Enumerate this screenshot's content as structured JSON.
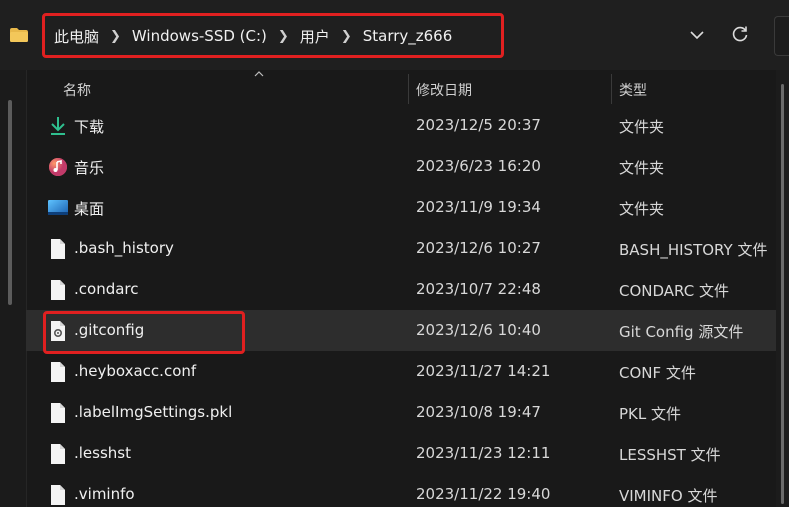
{
  "breadcrumb": [
    {
      "label": "此电脑"
    },
    {
      "label": "Windows-SSD (C:)"
    },
    {
      "label": "用户"
    },
    {
      "label": "Starry_z666"
    }
  ],
  "columns": {
    "name": "名称",
    "modified": "修改日期",
    "type": "类型"
  },
  "files": [
    {
      "name": "下载",
      "modified": "2023/12/5 20:37",
      "type": "文件夹",
      "icon": "download-folder-icon"
    },
    {
      "name": "音乐",
      "modified": "2023/6/23 16:20",
      "type": "文件夹",
      "icon": "music-folder-icon"
    },
    {
      "name": "桌面",
      "modified": "2023/11/9 19:34",
      "type": "文件夹",
      "icon": "desktop-folder-icon"
    },
    {
      "name": ".bash_history",
      "modified": "2023/12/6 10:27",
      "type": "BASH_HISTORY 文件",
      "icon": "file-icon"
    },
    {
      "name": ".condarc",
      "modified": "2023/10/7 22:48",
      "type": "CONDARC 文件",
      "icon": "file-icon"
    },
    {
      "name": ".gitconfig",
      "modified": "2023/12/6 10:40",
      "type": "Git Config 源文件",
      "icon": "config-file-icon",
      "selected": true
    },
    {
      "name": ".heyboxacc.conf",
      "modified": "2023/11/27 14:21",
      "type": "CONF 文件",
      "icon": "file-icon"
    },
    {
      "name": ".labelImgSettings.pkl",
      "modified": "2023/10/8 19:47",
      "type": "PKL 文件",
      "icon": "file-icon"
    },
    {
      "name": ".lesshst",
      "modified": "2023/11/23 12:11",
      "type": "LESSHST 文件",
      "icon": "file-icon"
    },
    {
      "name": ".viminfo",
      "modified": "2023/11/22 19:40",
      "type": "VIMINFO 文件",
      "icon": "file-icon"
    }
  ],
  "colors": {
    "highlight": "#e02020",
    "background": "#191919",
    "selected_row": "#2d2d2d",
    "accent_green": "#2fbf8f"
  }
}
